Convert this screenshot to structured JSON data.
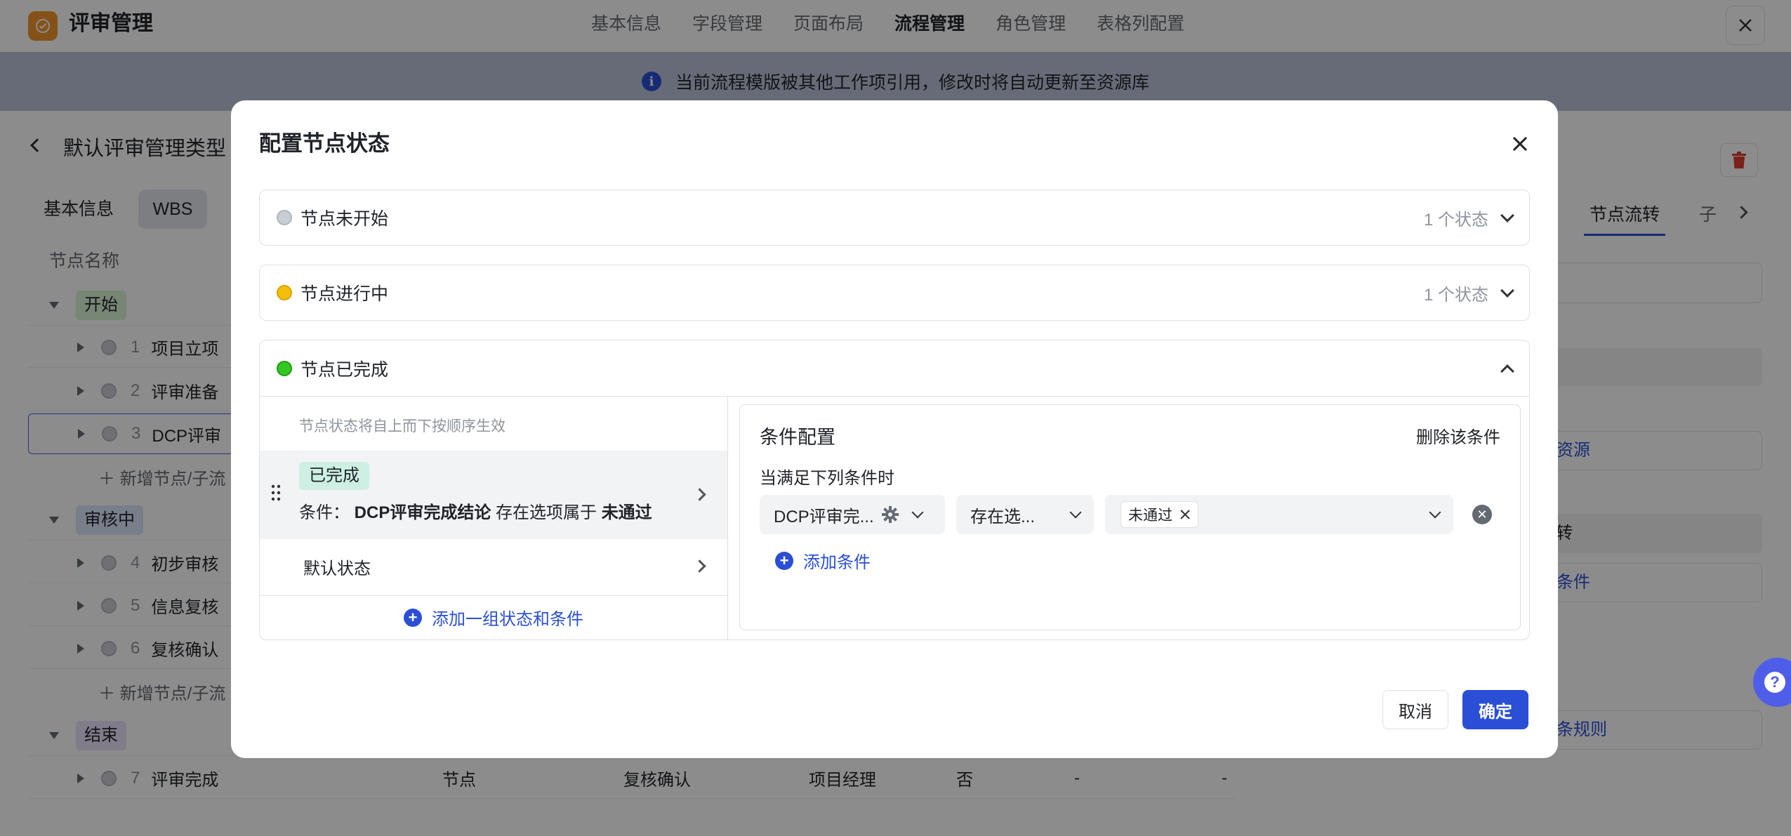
{
  "app": {
    "title": "评审管理"
  },
  "topnav": {
    "items": [
      "基本信息",
      "字段管理",
      "页面布局",
      "流程管理",
      "角色管理",
      "表格列配置"
    ],
    "active_index": 3
  },
  "banner": {
    "text": "当前流程模版被其他工作项引用，修改时将自动更新至资源库"
  },
  "background": {
    "page_title": "默认评审管理类型",
    "tabs": [
      "基本信息",
      "WBS"
    ],
    "column_header": "节点名称",
    "groups": [
      {
        "label": "开始",
        "nodes": [
          {
            "num": "1",
            "name": "项目立项"
          },
          {
            "num": "2",
            "name": "评审准备"
          },
          {
            "num": "3",
            "name": "DCP评审"
          }
        ],
        "add_label": "新增节点/子流"
      },
      {
        "label": "审核中",
        "nodes": [
          {
            "num": "4",
            "name": "初步审核"
          },
          {
            "num": "5",
            "name": "信息复核"
          },
          {
            "num": "6",
            "name": "复核确认"
          }
        ],
        "add_label": "新增节点/子流"
      },
      {
        "label": "结束",
        "nodes": [
          {
            "num": "7",
            "name": "评审完成"
          }
        ]
      }
    ],
    "last_row_cells": [
      "节点",
      "复核确认",
      "项目经理",
      "否",
      "-",
      "-"
    ],
    "right_tabs": [
      "节点流转",
      "子"
    ],
    "right_fragments": {
      "res": "资源",
      "transfer": "转",
      "cond": "条件",
      "rule": "条规则"
    }
  },
  "modal": {
    "title": "配置节点状态",
    "sections": [
      {
        "label": "节点未开始",
        "count": "1 个状态",
        "color": "#c9cdd4"
      },
      {
        "label": "节点进行中",
        "count": "1 个状态",
        "color": "#f5be0b"
      },
      {
        "label": "节点已完成",
        "color": "#34c724"
      }
    ],
    "hint": "节点状态将自上而下按顺序生效",
    "state_item": {
      "tag": "已完成",
      "cond_prefix": "条件：",
      "cond_field": "DCP评审完成结论",
      "cond_op": "存在选项属于",
      "cond_value": "未通过"
    },
    "default_state": "默认状态",
    "add_group": "添加一组状态和条件",
    "condition": {
      "title": "条件配置",
      "delete": "删除该条件",
      "subtitle": "当满足下列条件时",
      "field_select": "DCP评审完...",
      "op_select": "存在选...",
      "value_chip": "未通过",
      "add_condition": "添加条件"
    },
    "cancel": "取消",
    "ok": "确定"
  }
}
